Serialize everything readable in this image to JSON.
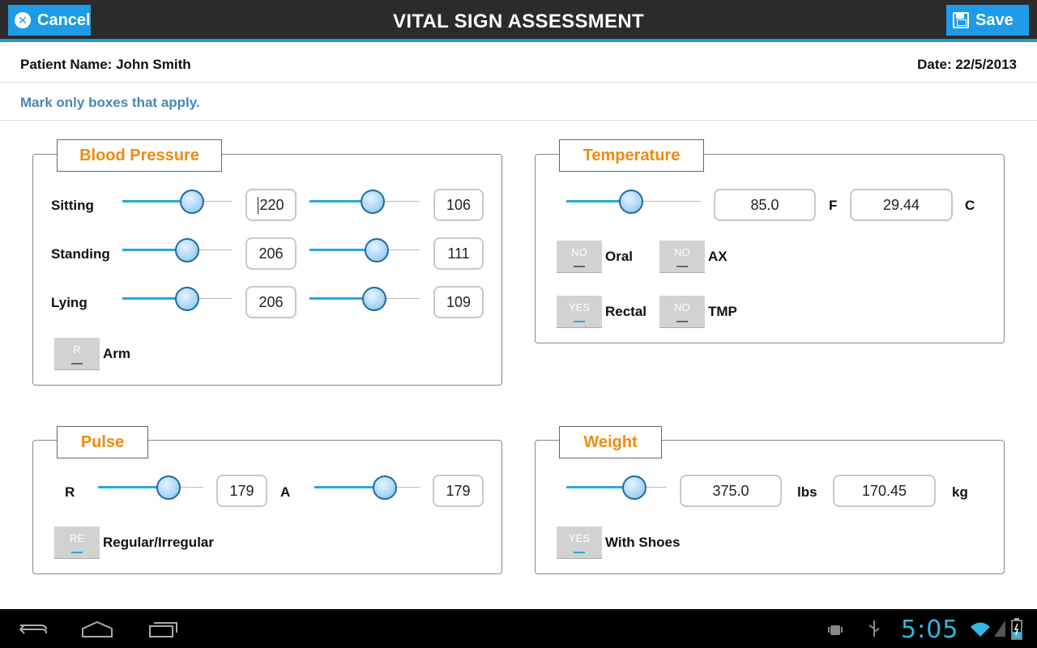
{
  "header": {
    "cancel_label": "Cancel",
    "title": "VITAL SIGN ASSESSMENT",
    "save_label": "Save"
  },
  "patient": {
    "name_text": "Patient Name:  John Smith",
    "date_text": "Date: 22/5/2013"
  },
  "instructions": "Mark only boxes that apply.",
  "blood_pressure": {
    "title": "Blood Pressure",
    "rows": [
      {
        "label": "Sitting",
        "systolic": "220",
        "diastolic": "106",
        "sys_level": 0.63,
        "dia_level": 0.57
      },
      {
        "label": "Standing",
        "systolic": "206",
        "diastolic": "111",
        "sys_level": 0.59,
        "dia_level": 0.61
      },
      {
        "label": "Lying",
        "systolic": "206",
        "diastolic": "109",
        "sys_level": 0.59,
        "dia_level": 0.59
      }
    ],
    "arm_toggle": "R",
    "arm_label": "Arm"
  },
  "temperature": {
    "title": "Temperature",
    "level": 0.48,
    "fahrenheit": "85.0",
    "f_unit": "F",
    "celsius": "29.44",
    "c_unit": "C",
    "options": [
      {
        "toggle": "NO",
        "label": "Oral"
      },
      {
        "toggle": "NO",
        "label": "AX"
      },
      {
        "toggle": "YES",
        "label": "Rectal"
      },
      {
        "toggle": "NO",
        "label": "TMP"
      }
    ]
  },
  "pulse": {
    "title": "Pulse",
    "r_label": "R",
    "r_value": "179",
    "r_level": 0.67,
    "a_label": "A",
    "a_value": "179",
    "a_level": 0.67,
    "rhythm_toggle": "RE",
    "rhythm_label": "Regular/Irregular"
  },
  "weight": {
    "title": "Weight",
    "level": 0.68,
    "lbs": "375.0",
    "lbs_unit": "lbs",
    "kg": "170.45",
    "kg_unit": "kg",
    "shoes_toggle": "YES",
    "shoes_label": "With Shoes"
  },
  "system_bar": {
    "clock": "5:05"
  },
  "colors": {
    "accent": "#1e9be8",
    "legend_text": "#f08a10",
    "instruction_text": "#4a86b4",
    "clock": "#33b5e5"
  }
}
